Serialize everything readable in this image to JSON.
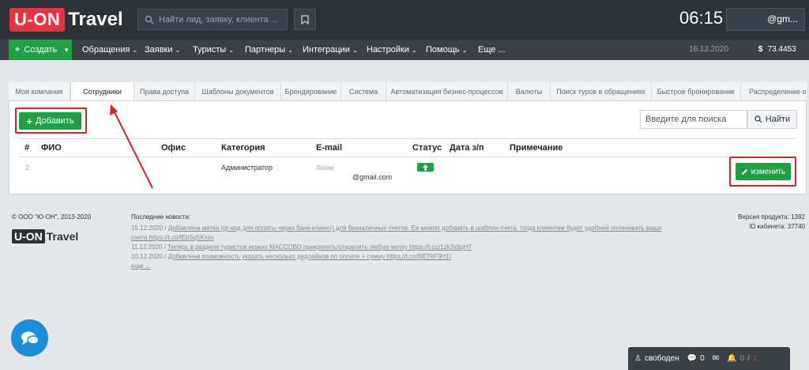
{
  "header": {
    "logo_left": "U-ON",
    "logo_right": "Travel",
    "search_placeholder": "Найти лид, заявку, клиента ...",
    "clock": "06:15",
    "user": "@gm..."
  },
  "nav": {
    "create_label": "Создать",
    "items": [
      "Обращения",
      "Заявки",
      "Туристы",
      "Партнеры",
      "Интеграции",
      "Настройки",
      "Помощь",
      "Еще ..."
    ],
    "date": "16.12.2020",
    "balance": "73.4453"
  },
  "tabs": [
    "Моя компания",
    "Сотрудники",
    "Права доступа",
    "Шаблоны документов",
    "Брендирование",
    "Система",
    "Автоматизация бизнес-процессов",
    "Валюты",
    "Поиск туров в обращениях",
    "Быстрое бронирование",
    "Распределение об"
  ],
  "toolbar": {
    "add_label": "Добавить",
    "search_placeholder": "Введите для поиска",
    "find_label": "Найти"
  },
  "table": {
    "headers": [
      "#",
      "ФИО",
      "Офис",
      "Категория",
      "E-mail",
      "Статус",
      "Дата з/п",
      "Примечание"
    ],
    "row": {
      "num": "2",
      "category": "Администратор",
      "login_label": "Логин:",
      "email": "@gmail.com",
      "edit_label": "изменить"
    }
  },
  "footer": {
    "copyright": "© ООО \"Ю-ОН\", 2013-2020",
    "logo_left": "U-ON",
    "logo_right": "Travel",
    "news_title": "Последние новости:",
    "news": [
      {
        "date": "15.12.2020 /",
        "text": "Добавлена метка {qr-код для оплаты через банк-клиент} для безналичных счетов. Ее можно добавить в шаблон счета, тогда клиентам будет удобней оплачивать ваши"
      },
      {
        "date": "",
        "text": "счета https://t.co/lEbSq5Kxxx"
      },
      {
        "date": "11.12.2020 /",
        "text": "Теперь в разделе туристов можно МАССОВО прикрепить/открепить любую метку https://t.co/1zk3idlqHT"
      },
      {
        "date": "10.12.2020 /",
        "text": "Добавлена возможность указать несколько дедлайнов по оплате + сумму https://t.co/0lETkF9H1I"
      }
    ],
    "more": "еще ...",
    "version": "Версия продукта: 1392",
    "cabinet": "ID кабинета: 37740"
  },
  "statusbar": {
    "status": "свободен",
    "messages": "0",
    "count_green": "0",
    "count_red": "1"
  }
}
